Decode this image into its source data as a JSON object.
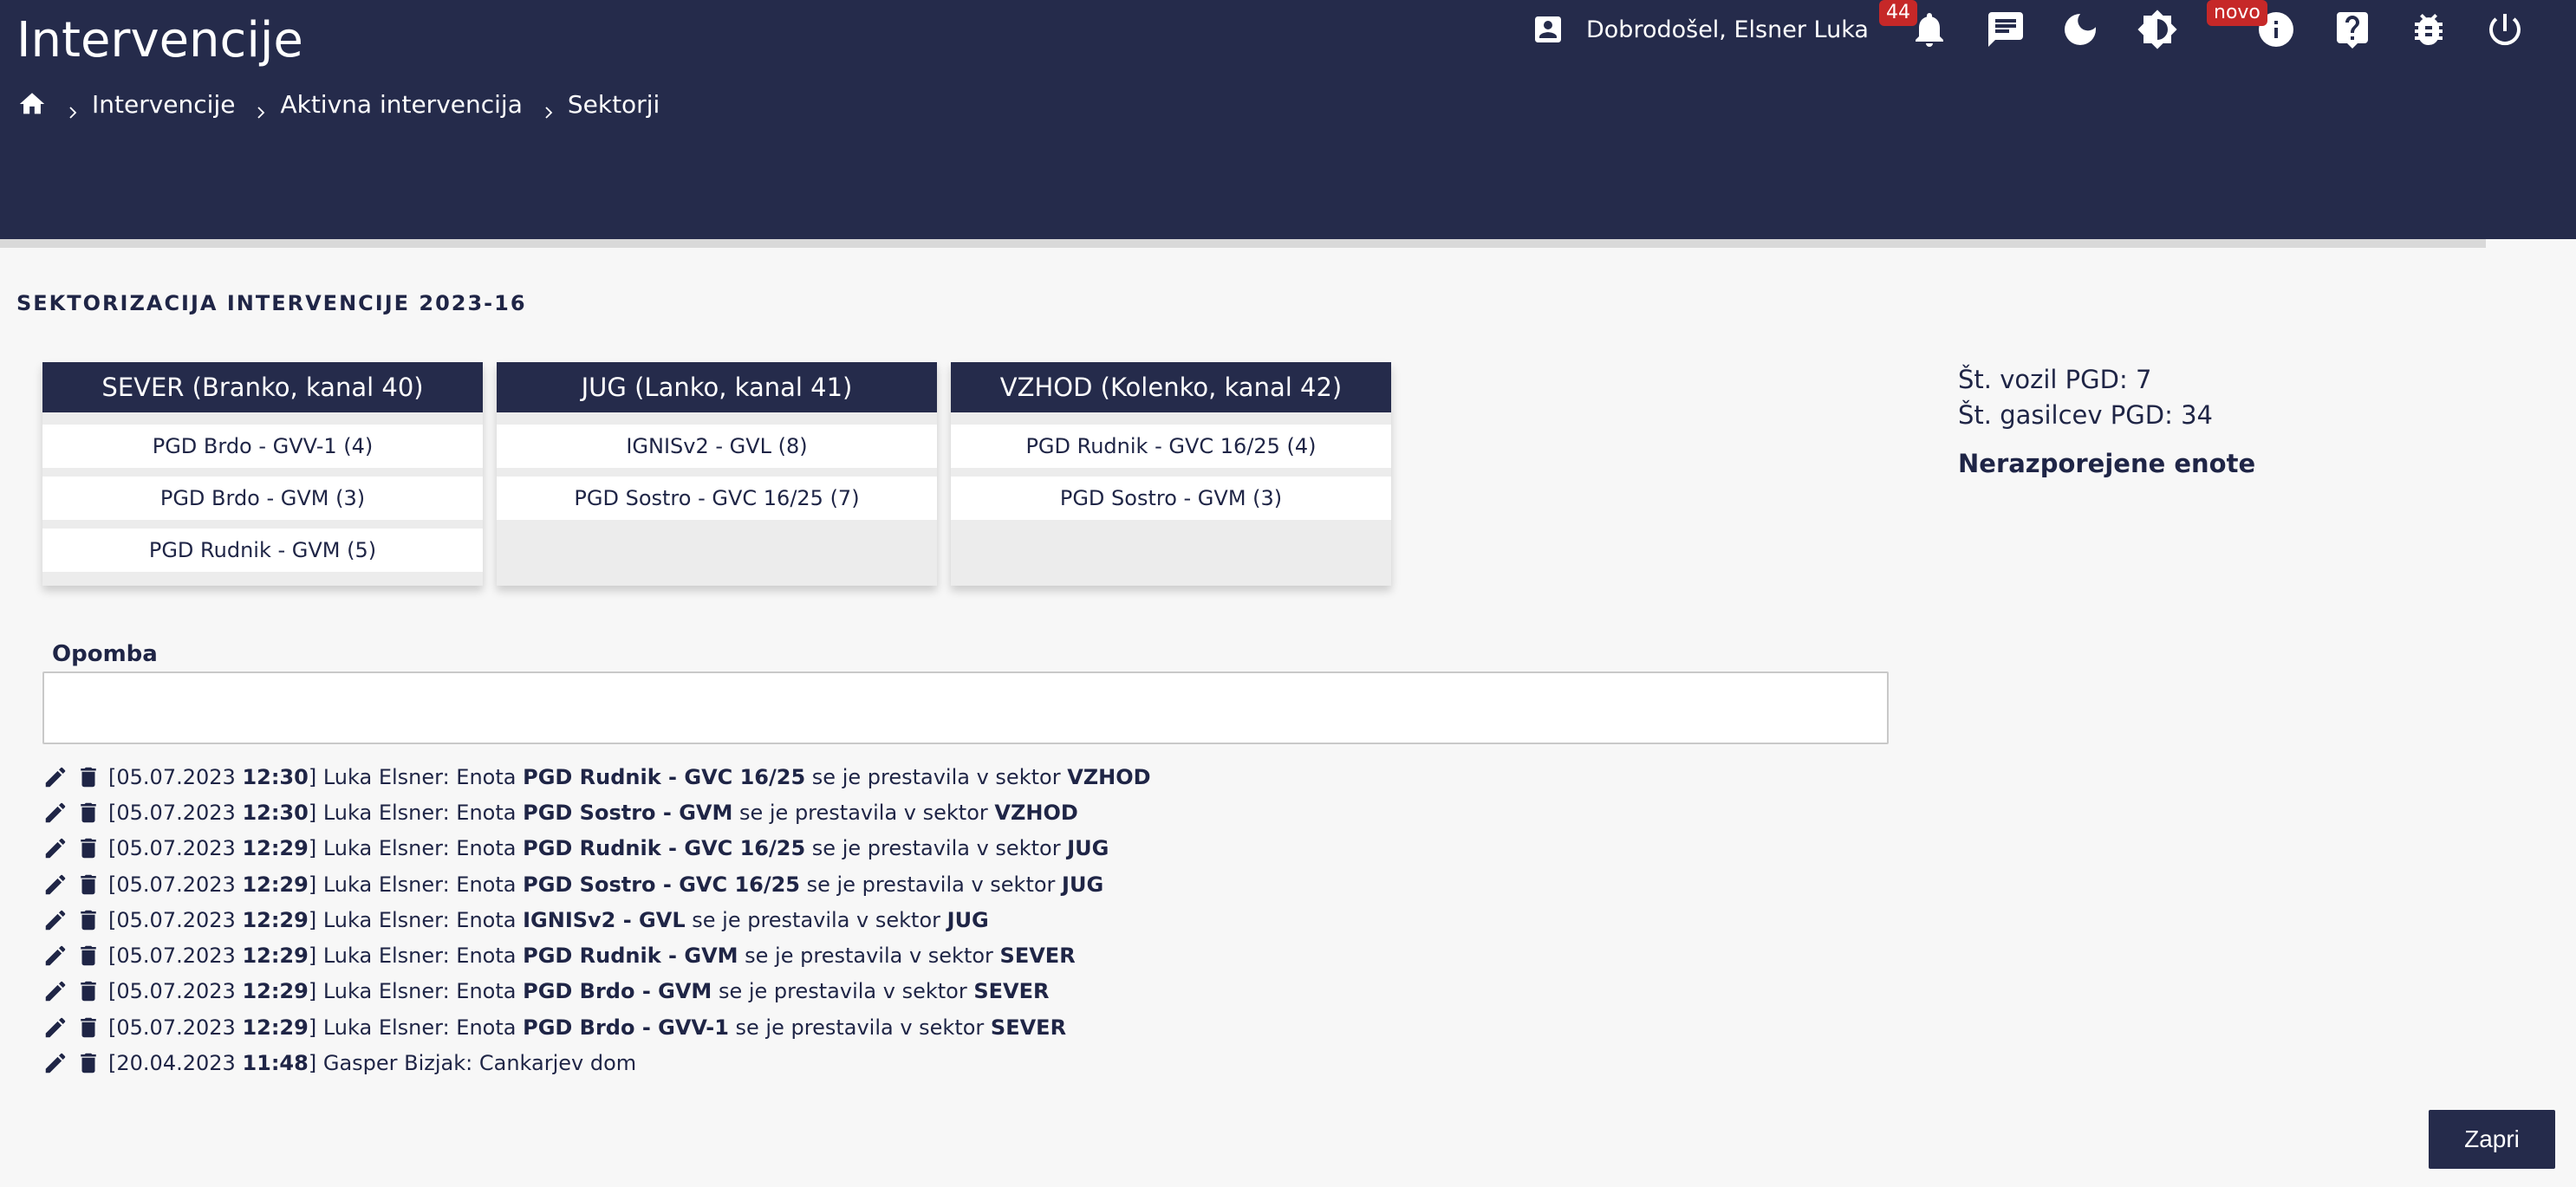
{
  "header": {
    "title": "Intervencije",
    "breadcrumb": [
      "Intervencije",
      "Aktivna intervencija",
      "Sektorji"
    ],
    "welcome": "Dobrodošel, Elsner Luka",
    "notifications_badge": "44",
    "new_badge": "novo",
    "icons": [
      "home-icon",
      "account-box-icon",
      "bell-icon",
      "chat-icon",
      "moon-icon",
      "brightness-icon",
      "info-icon",
      "help-icon",
      "bug-icon",
      "power-icon"
    ]
  },
  "section_title": "SEKTORIZACIJA INTERVENCIJE 2023-16",
  "sectors": [
    {
      "name": "SEVER (Branko, kanal 40)",
      "units": [
        "PGD Brdo - GVV-1 (4)",
        "PGD Brdo - GVM (3)",
        "PGD Rudnik - GVM (5)"
      ]
    },
    {
      "name": "JUG (Lanko, kanal 41)",
      "units": [
        "IGNISv2 - GVL (8)",
        "PGD Sostro - GVC 16/25 (7)"
      ]
    },
    {
      "name": "VZHOD (Kolenko, kanal 42)",
      "units": [
        "PGD Rudnik - GVC 16/25 (4)",
        "PGD Sostro - GVM (3)"
      ]
    }
  ],
  "stats": {
    "vehicles": "Št. vozil PGD: 7",
    "firefighters": "Št. gasilcev PGD: 34",
    "unassigned_title": "Nerazporejene enote"
  },
  "note": {
    "label": "Opomba",
    "value": ""
  },
  "log": [
    {
      "date": "05.07.2023",
      "time": "12:30",
      "author": "Luka Elsner",
      "pre": "Enota ",
      "unit": "PGD Rudnik - GVC 16/25",
      "mid": " se je prestavila v sektor ",
      "sector": "VZHOD"
    },
    {
      "date": "05.07.2023",
      "time": "12:30",
      "author": "Luka Elsner",
      "pre": "Enota ",
      "unit": "PGD Sostro - GVM",
      "mid": " se je prestavila v sektor ",
      "sector": "VZHOD"
    },
    {
      "date": "05.07.2023",
      "time": "12:29",
      "author": "Luka Elsner",
      "pre": "Enota ",
      "unit": "PGD Rudnik - GVC 16/25",
      "mid": " se je prestavila v sektor ",
      "sector": "JUG"
    },
    {
      "date": "05.07.2023",
      "time": "12:29",
      "author": "Luka Elsner",
      "pre": "Enota ",
      "unit": "PGD Sostro - GVC 16/25",
      "mid": " se je prestavila v sektor ",
      "sector": "JUG"
    },
    {
      "date": "05.07.2023",
      "time": "12:29",
      "author": "Luka Elsner",
      "pre": "Enota ",
      "unit": "IGNISv2 - GVL",
      "mid": " se je prestavila v sektor ",
      "sector": "JUG"
    },
    {
      "date": "05.07.2023",
      "time": "12:29",
      "author": "Luka Elsner",
      "pre": "Enota ",
      "unit": "PGD Rudnik - GVM",
      "mid": " se je prestavila v sektor ",
      "sector": "SEVER"
    },
    {
      "date": "05.07.2023",
      "time": "12:29",
      "author": "Luka Elsner",
      "pre": "Enota ",
      "unit": "PGD Brdo - GVM",
      "mid": " se je prestavila v sektor ",
      "sector": "SEVER"
    },
    {
      "date": "05.07.2023",
      "time": "12:29",
      "author": "Luka Elsner",
      "pre": "Enota ",
      "unit": "PGD Brdo - GVV-1",
      "mid": " se je prestavila v sektor ",
      "sector": "SEVER"
    },
    {
      "date": "20.04.2023",
      "time": "11:48",
      "author": "Gasper Bizjak",
      "pre": "Cankarjev dom",
      "unit": "",
      "mid": "",
      "sector": ""
    }
  ],
  "close_label": "Zapri",
  "colors": {
    "navy": "#252b4b",
    "badge_red": "#c62828",
    "background": "#f7f7f7"
  }
}
